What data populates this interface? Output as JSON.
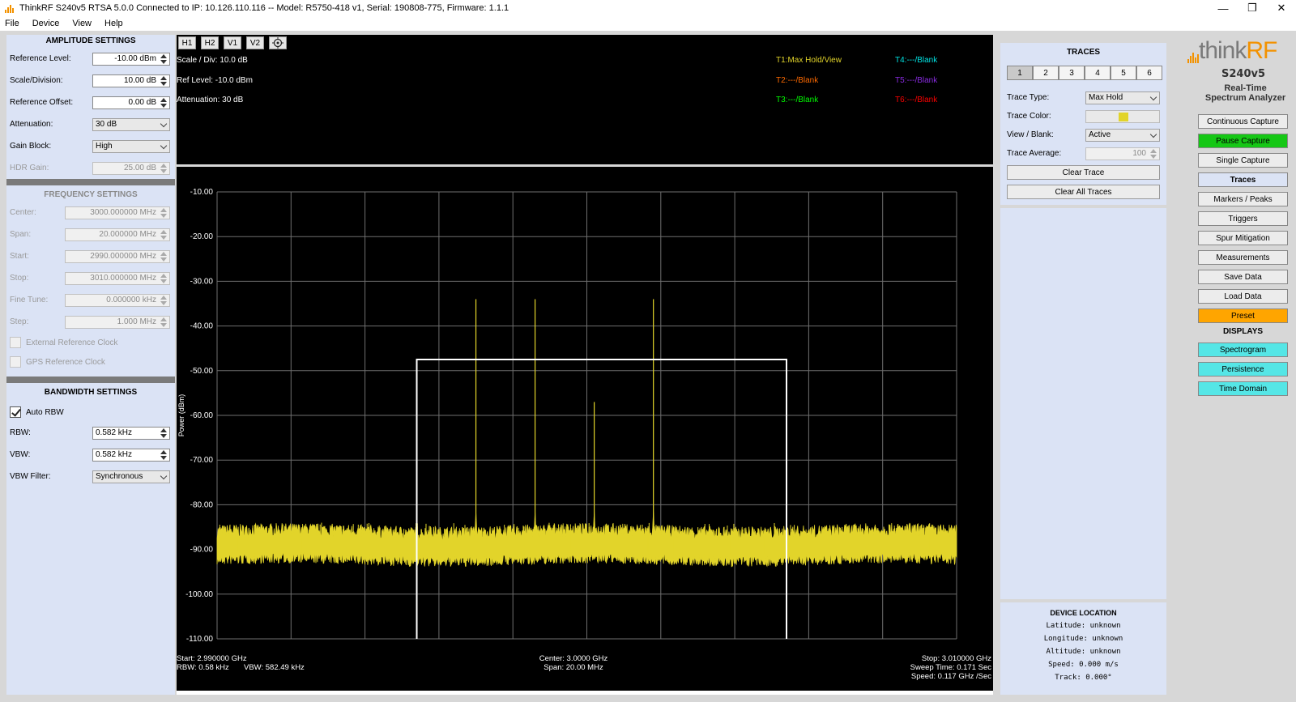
{
  "window": {
    "title": "ThinkRF S240v5 RTSA 5.0.0 Connected to IP: 10.126.110.116 -- Model: R5750-418 v1, Serial: 190808-775, Firmware: 1.1.1",
    "controls": {
      "minimize": "—",
      "restore": "❐",
      "close": "✕"
    }
  },
  "menu": [
    "File",
    "Device",
    "View",
    "Help"
  ],
  "amplitude": {
    "title": "AMPLITUDE SETTINGS",
    "reference_level": {
      "label": "Reference Level:",
      "value": "-10.00 dBm"
    },
    "scale_division": {
      "label": "Scale/Division:",
      "value": "10.00 dB"
    },
    "reference_offset": {
      "label": "Reference Offset:",
      "value": "0.00 dB"
    },
    "attenuation": {
      "label": "Attenuation:",
      "value": "30 dB"
    },
    "gain_block": {
      "label": "Gain Block:",
      "value": "High"
    },
    "hdr_gain": {
      "label": "HDR Gain:",
      "value": "25.00 dB"
    }
  },
  "frequency": {
    "title": "FREQUENCY SETTINGS",
    "center": {
      "label": "Center:",
      "value": "3000.000000 MHz"
    },
    "span": {
      "label": "Span:",
      "value": "20.000000 MHz"
    },
    "start": {
      "label": "Start:",
      "value": "2990.000000 MHz"
    },
    "stop": {
      "label": "Stop:",
      "value": "3010.000000 MHz"
    },
    "fine_tune": {
      "label": "Fine Tune:",
      "value": "0.000000 kHz"
    },
    "step": {
      "label": "Step:",
      "value": "1.000 MHz"
    },
    "ext_ref": "External Reference Clock",
    "gps_ref": "GPS Reference Clock"
  },
  "bandwidth": {
    "title": "BANDWIDTH SETTINGS",
    "auto_rbw": "Auto RBW",
    "rbw": {
      "label": "RBW:",
      "value": "0.582 kHz"
    },
    "vbw": {
      "label": "VBW:",
      "value": "0.582 kHz"
    },
    "vbw_filter": {
      "label": "VBW Filter:",
      "value": "Synchronous"
    }
  },
  "toolbar": {
    "h1": "H1",
    "h2": "H2",
    "v1": "V1",
    "v2": "V2"
  },
  "info": {
    "scale": "Scale / Div: 10.0 dB",
    "ref": "Ref Level: -10.0 dBm",
    "atten": "Attenuation: 30 dB",
    "traces": [
      {
        "label": "T1:Max Hold/View",
        "color": "#e2d42a"
      },
      {
        "label": "T2:---/Blank",
        "color": "#ff6a00"
      },
      {
        "label": "T3:---/Blank",
        "color": "#00ff00"
      },
      {
        "label": "T4:---/Blank",
        "color": "#00e5e5"
      },
      {
        "label": "T5:---/Blank",
        "color": "#8a2be2"
      },
      {
        "label": "T6:---/Blank",
        "color": "#ff0000"
      }
    ]
  },
  "plot": {
    "ylabel": "Power (dBm)",
    "yticks": [
      "-10.00",
      "-20.00",
      "-30.00",
      "-40.00",
      "-50.00",
      "-60.00",
      "-70.00",
      "-80.00",
      "-90.00",
      "-100.00",
      "-110.00"
    ],
    "ymax": -10,
    "ymin": -110,
    "xdivisions": 10,
    "trace_color": "#e2d42a",
    "noise_floor_dbm": -89,
    "peaks": [
      {
        "freq_mhz": 2997.0,
        "dbm": -34
      },
      {
        "freq_mhz": 2998.6,
        "dbm": -34
      },
      {
        "freq_mhz": 3000.2,
        "dbm": -57
      },
      {
        "freq_mhz": 3001.8,
        "dbm": -34
      }
    ],
    "box": {
      "start_mhz": 2995.4,
      "stop_mhz": 3005.4,
      "level_dbm": -47.5
    },
    "start_mhz": 2990,
    "stop_mhz": 3010,
    "footer": {
      "start": "Start: 2.990000 GHz",
      "rbw": "RBW: 0.58 kHz",
      "vbw": "VBW: 582.49 kHz",
      "center": "Center: 3.0000 GHz",
      "span": "Span: 20.00 MHz",
      "stop": "Stop: 3.010000 GHz",
      "sweep": "Sweep Time: 0.171 Sec",
      "speed": "Speed: 0.117 GHz /Sec"
    }
  },
  "traces_panel": {
    "title": "TRACES",
    "tabs": [
      "1",
      "2",
      "3",
      "4",
      "5",
      "6"
    ],
    "trace_type": {
      "label": "Trace Type:",
      "value": "Max Hold"
    },
    "trace_color": {
      "label": "Trace Color:"
    },
    "view_blank": {
      "label": "View / Blank:",
      "value": "Active"
    },
    "trace_average": {
      "label": "Trace Average:",
      "value": "100"
    },
    "clear_trace": "Clear Trace",
    "clear_all": "Clear All Traces"
  },
  "device_location": {
    "title": "DEVICE LOCATION",
    "latitude": "Latitude: unknown",
    "longitude": "Longitude: unknown",
    "altitude": "Altitude: unknown",
    "speed": "Speed: 0.000 m/s",
    "track": "Track: 0.000°"
  },
  "brand": {
    "logo_a": "think",
    "logo_b": "RF",
    "model": "S240v5",
    "sub1": "Real-Time",
    "sub2": "Spectrum Analyzer"
  },
  "right_buttons": {
    "continuous": "Continuous Capture",
    "pause": "Pause Capture",
    "single": "Single Capture",
    "traces": "Traces",
    "markers": "Markers / Peaks",
    "triggers": "Triggers",
    "spur": "Spur Mitigation",
    "measurements": "Measurements",
    "save": "Save Data",
    "load": "Load Data",
    "preset": "Preset",
    "displays_head": "DISPLAYS",
    "spectrogram": "Spectrogram",
    "persistence": "Persistence",
    "time_domain": "Time Domain"
  }
}
